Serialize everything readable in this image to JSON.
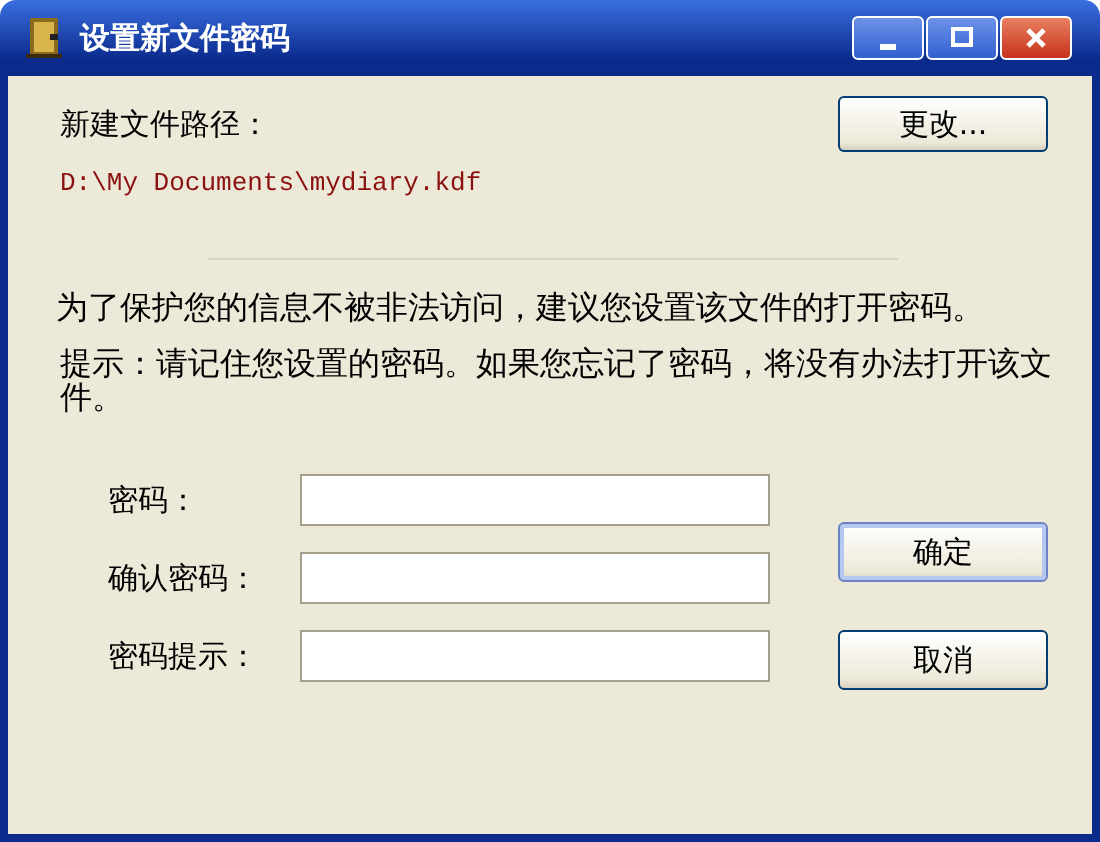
{
  "window": {
    "title": "设置新文件密码"
  },
  "path_label": "新建文件路径：",
  "change_button": "更改...",
  "path": "D:\\My Documents\\mydiary.kdf",
  "info": "为了保护您的信息不被非法访问，建议您设置该文件的打开密码。",
  "hint": "提示：请记住您设置的密码。如果您忘记了密码，将没有办法打开该文件。",
  "fields": [
    {
      "label": "密码："
    },
    {
      "label": "确认密码："
    },
    {
      "label": "密码提示："
    }
  ],
  "buttons": [
    {
      "label": "确定",
      "default": true
    },
    {
      "label": "取消",
      "default": false
    }
  ]
}
